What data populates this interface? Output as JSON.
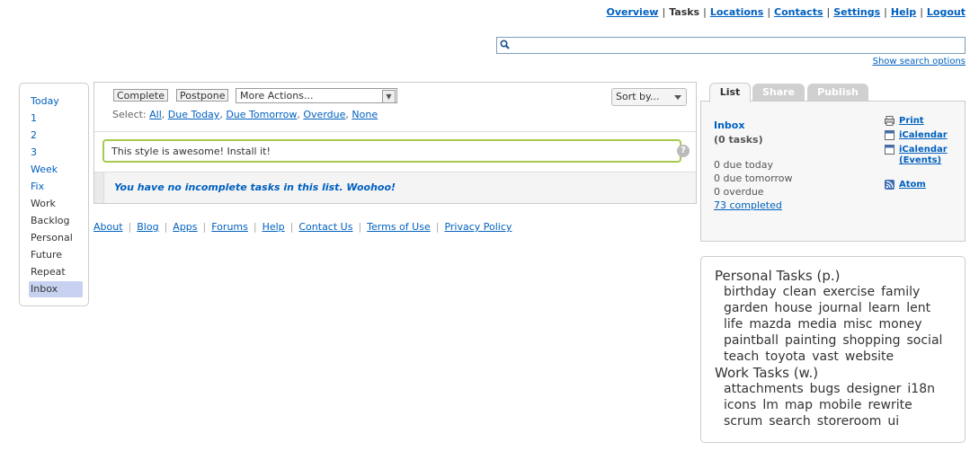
{
  "nav": {
    "items": [
      "Overview",
      "Tasks",
      "Locations",
      "Contacts",
      "Settings",
      "Help",
      "Logout"
    ],
    "current": "Tasks"
  },
  "search": {
    "value": "",
    "options_link": "Show search options"
  },
  "lists": [
    "Today",
    "1",
    "2",
    "3",
    "Week",
    "Fix",
    "Work",
    "Backlog",
    "Personal",
    "Future",
    "Repeat",
    "Inbox"
  ],
  "lists_selected": "Inbox",
  "toolbar": {
    "complete": "Complete",
    "postpone": "Postpone",
    "more_actions": "More Actions...",
    "sort_by": "Sort by...",
    "select_label": "Select:",
    "select_links": [
      "All",
      "Due Today",
      "Due Tomorrow",
      "Overdue",
      "None"
    ]
  },
  "add_task": {
    "value": "This style is awesome! Install it!",
    "help": "?"
  },
  "empty_message": "You have no incomplete tasks in this list. Woohoo!",
  "footer": [
    "About",
    "Blog",
    "Apps",
    "Forums",
    "Help",
    "Contact Us",
    "Terms of Use",
    "Privacy Policy"
  ],
  "tabs": [
    "List",
    "Share",
    "Publish"
  ],
  "list_info": {
    "title": "Inbox",
    "count": "(0 tasks)",
    "due_today": "0 due today",
    "due_tomorrow": "0 due tomorrow",
    "overdue": "0 overdue",
    "completed": "73 completed",
    "print": "Print",
    "icalendar": "iCalendar",
    "icalendar_events": "iCalendar (Events)",
    "atom": "Atom"
  },
  "tags": {
    "personal_title": "Personal Tasks (p.)",
    "personal_lines": [
      [
        "birthday",
        "clean",
        "exercise",
        "family"
      ],
      [
        "garden",
        "house",
        "journal",
        "learn",
        "lent"
      ],
      [
        "life",
        "mazda",
        "media",
        "misc",
        "money"
      ],
      [
        "paintball",
        "painting",
        "shopping",
        "social"
      ],
      [
        "teach",
        "toyota",
        "vast",
        "website"
      ]
    ],
    "work_title": "Work Tasks (w.)",
    "work_lines": [
      [
        "attachments",
        "bugs",
        "designer",
        "i18n"
      ],
      [
        "icons",
        "lm",
        "map",
        "mobile",
        "rewrite"
      ],
      [
        "scrum",
        "search",
        "storeroom",
        "ui"
      ]
    ]
  },
  "colors": {
    "link": "#0060bf",
    "selected_list": "#c6d2f0",
    "input_border": "#a7c94e"
  },
  "icons": [
    "search-icon",
    "print-icon",
    "calendar-icon",
    "rss-icon",
    "help-icon"
  ]
}
